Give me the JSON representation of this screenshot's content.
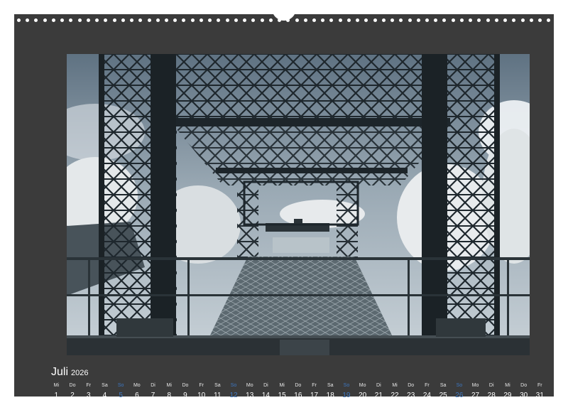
{
  "calendar": {
    "month": "Juli",
    "year": "2026",
    "days": [
      {
        "wd": "Mi",
        "d": "1"
      },
      {
        "wd": "Do",
        "d": "2"
      },
      {
        "wd": "Fr",
        "d": "3"
      },
      {
        "wd": "Sa",
        "d": "4"
      },
      {
        "wd": "So",
        "d": "5",
        "sun": true
      },
      {
        "wd": "Mo",
        "d": "6"
      },
      {
        "wd": "Di",
        "d": "7"
      },
      {
        "wd": "Mi",
        "d": "8"
      },
      {
        "wd": "Do",
        "d": "9"
      },
      {
        "wd": "Fr",
        "d": "10"
      },
      {
        "wd": "Sa",
        "d": "11"
      },
      {
        "wd": "So",
        "d": "12",
        "sun": true
      },
      {
        "wd": "Mo",
        "d": "13"
      },
      {
        "wd": "Di",
        "d": "14"
      },
      {
        "wd": "Mi",
        "d": "15"
      },
      {
        "wd": "Do",
        "d": "16"
      },
      {
        "wd": "Fr",
        "d": "17"
      },
      {
        "wd": "Sa",
        "d": "18"
      },
      {
        "wd": "So",
        "d": "19",
        "sun": true
      },
      {
        "wd": "Mo",
        "d": "20"
      },
      {
        "wd": "Di",
        "d": "21"
      },
      {
        "wd": "Mi",
        "d": "22"
      },
      {
        "wd": "Do",
        "d": "23"
      },
      {
        "wd": "Fr",
        "d": "24"
      },
      {
        "wd": "Sa",
        "d": "25"
      },
      {
        "wd": "So",
        "d": "26",
        "sun": true
      },
      {
        "wd": "Mo",
        "d": "27"
      },
      {
        "wd": "Di",
        "d": "28"
      },
      {
        "wd": "Mi",
        "d": "29"
      },
      {
        "wd": "Do",
        "d": "30"
      },
      {
        "wd": "Fr",
        "d": "31"
      }
    ]
  },
  "colors": {
    "background": "#3b3b3b",
    "text": "#ffffff",
    "sunday": "#3d78c2"
  }
}
